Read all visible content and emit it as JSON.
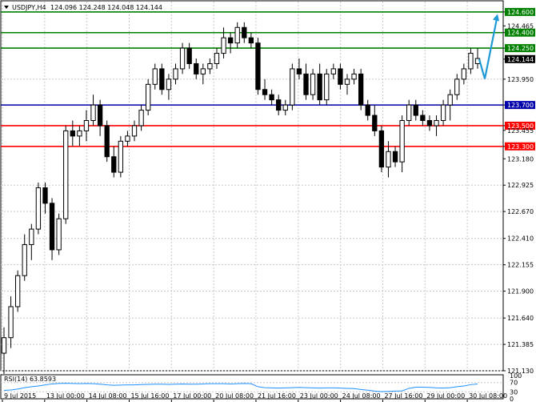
{
  "header": {
    "symbol": "USDJPY,H4",
    "ohlc": "124.096 124.248 124.048 124.144"
  },
  "colors": {
    "green_level": "#008000",
    "blue_level": "#0000aa",
    "red_level": "#ff0000",
    "rsi_line": "#1e90ff",
    "forecast_arrow": "#1e9ad6",
    "grid": "#c8c8c8",
    "candle": "#000000"
  },
  "chart_data": [
    {
      "type": "candlestick",
      "title": "USDJPY,H4",
      "ohlc_text": "124.096 124.248 124.048 124.144",
      "ylim": [
        121.13,
        124.7
      ],
      "y_ticks": [
        "124.600",
        "124.465",
        "124.400",
        "124.250",
        "124.144",
        "123.950",
        "123.700",
        "123.500",
        "123.455",
        "123.300",
        "123.180",
        "122.925",
        "122.670",
        "122.410",
        "122.155",
        "121.900",
        "121.640",
        "121.385",
        "121.130"
      ],
      "x_tick_labels": [
        "9 Jul 2015",
        "13 Jul 00:00",
        "14 Jul 08:00",
        "15 Jul 16:00",
        "17 Jul 00:00",
        "20 Jul 08:00",
        "21 Jul 16:00",
        "23 Jul 00:00",
        "24 Jul 08:00",
        "27 Jul 16:00",
        "29 Jul 00:00",
        "30 Jul 08:00"
      ],
      "current_price": 124.144,
      "levels": [
        {
          "label": "124.600",
          "value": 124.6,
          "color": "green"
        },
        {
          "label": "124.400",
          "value": 124.4,
          "color": "green"
        },
        {
          "label": "124.250",
          "value": 124.25,
          "color": "green"
        },
        {
          "label": "123.700",
          "value": 123.7,
          "color": "blue"
        },
        {
          "label": "123.500",
          "value": 123.5,
          "color": "red"
        },
        {
          "label": "123.300",
          "value": 123.3,
          "color": "red"
        }
      ],
      "candles": [
        [
          121.3,
          121.55,
          121.1,
          121.45
        ],
        [
          121.45,
          121.85,
          121.35,
          121.75
        ],
        [
          121.75,
          122.1,
          121.7,
          122.05
        ],
        [
          122.05,
          122.45,
          122.0,
          122.35
        ],
        [
          122.35,
          122.55,
          122.2,
          122.5
        ],
        [
          122.5,
          122.95,
          122.45,
          122.9
        ],
        [
          122.9,
          122.95,
          122.65,
          122.75
        ],
        [
          122.75,
          122.8,
          122.2,
          122.3
        ],
        [
          122.3,
          122.65,
          122.25,
          122.6
        ],
        [
          122.6,
          123.5,
          122.55,
          123.45
        ],
        [
          123.45,
          123.55,
          123.3,
          123.4
        ],
        [
          123.4,
          123.5,
          123.3,
          123.45
        ],
        [
          123.45,
          123.65,
          123.35,
          123.55
        ],
        [
          123.55,
          123.8,
          123.5,
          123.7
        ],
        [
          123.7,
          123.75,
          123.4,
          123.5
        ],
        [
          123.5,
          123.55,
          123.15,
          123.2
        ],
        [
          123.2,
          123.3,
          123.0,
          123.05
        ],
        [
          123.05,
          123.4,
          123.0,
          123.35
        ],
        [
          123.35,
          123.45,
          123.3,
          123.4
        ],
        [
          123.4,
          123.55,
          123.35,
          123.5
        ],
        [
          123.5,
          123.7,
          123.45,
          123.65
        ],
        [
          123.65,
          123.95,
          123.6,
          123.9
        ],
        [
          123.9,
          124.1,
          123.85,
          124.05
        ],
        [
          124.05,
          124.1,
          123.8,
          123.85
        ],
        [
          123.85,
          124.0,
          123.75,
          123.95
        ],
        [
          123.95,
          124.1,
          123.9,
          124.05
        ],
        [
          124.05,
          124.3,
          124.0,
          124.25
        ],
        [
          124.25,
          124.3,
          124.05,
          124.1
        ],
        [
          124.1,
          124.15,
          123.95,
          124.0
        ],
        [
          124.0,
          124.1,
          123.9,
          124.05
        ],
        [
          124.05,
          124.15,
          124.0,
          124.1
        ],
        [
          124.1,
          124.25,
          124.05,
          124.2
        ],
        [
          124.2,
          124.45,
          124.15,
          124.35
        ],
        [
          124.35,
          124.4,
          124.2,
          124.3
        ],
        [
          124.3,
          124.5,
          124.25,
          124.45
        ],
        [
          124.45,
          124.5,
          124.3,
          124.35
        ],
        [
          124.35,
          124.4,
          124.25,
          124.3
        ],
        [
          124.3,
          124.35,
          123.8,
          123.85
        ],
        [
          123.85,
          123.95,
          123.75,
          123.8
        ],
        [
          123.8,
          123.85,
          123.7,
          123.75
        ],
        [
          123.75,
          123.8,
          123.6,
          123.65
        ],
        [
          123.65,
          123.75,
          123.6,
          123.7
        ],
        [
          123.7,
          124.1,
          123.65,
          124.05
        ],
        [
          124.05,
          124.15,
          123.95,
          124.0
        ],
        [
          124.0,
          124.1,
          123.75,
          123.8
        ],
        [
          123.8,
          124.05,
          123.75,
          124.0
        ],
        [
          124.0,
          124.1,
          123.7,
          123.75
        ],
        [
          123.75,
          124.05,
          123.7,
          124.0
        ],
        [
          124.0,
          124.1,
          123.95,
          124.05
        ],
        [
          124.05,
          124.1,
          123.85,
          123.9
        ],
        [
          123.9,
          124.0,
          123.8,
          123.95
        ],
        [
          123.95,
          124.05,
          123.9,
          124.0
        ],
        [
          124.0,
          124.05,
          123.65,
          123.7
        ],
        [
          123.7,
          123.75,
          123.55,
          123.6
        ],
        [
          123.6,
          123.7,
          123.4,
          123.45
        ],
        [
          123.45,
          123.5,
          123.05,
          123.1
        ],
        [
          123.1,
          123.35,
          123.0,
          123.25
        ],
        [
          123.25,
          123.3,
          123.1,
          123.15
        ],
        [
          123.15,
          123.6,
          123.05,
          123.55
        ],
        [
          123.55,
          123.75,
          123.5,
          123.7
        ],
        [
          123.7,
          123.75,
          123.55,
          123.6
        ],
        [
          123.6,
          123.65,
          123.5,
          123.55
        ],
        [
          123.55,
          123.6,
          123.45,
          123.5
        ],
        [
          123.5,
          123.6,
          123.4,
          123.55
        ],
        [
          123.55,
          123.75,
          123.5,
          123.7
        ],
        [
          123.7,
          123.85,
          123.55,
          123.8
        ],
        [
          123.8,
          124.0,
          123.75,
          123.95
        ],
        [
          123.95,
          124.1,
          123.9,
          124.05
        ],
        [
          124.05,
          124.25,
          124.0,
          124.2
        ],
        [
          124.1,
          124.25,
          124.05,
          124.15
        ]
      ],
      "forecast_arrow": {
        "from_price": 124.144,
        "dip_price": 124.0,
        "to_price": 124.58
      }
    },
    {
      "type": "line",
      "title": "RSI(14) 63.8593",
      "ylim": [
        0,
        100
      ],
      "y_ticks": [
        "100",
        "70",
        "30",
        "0"
      ],
      "levels": [
        70,
        30
      ],
      "series": [
        {
          "name": "RSI(14)",
          "values": [
            36,
            38,
            42,
            48,
            52,
            55,
            60,
            64,
            66,
            67,
            66,
            65,
            66,
            65,
            63,
            60,
            58,
            59,
            60,
            60,
            61,
            62,
            63,
            63,
            62,
            63,
            64,
            63,
            63,
            64,
            65,
            65,
            65,
            64,
            65,
            66,
            65,
            52,
            48,
            47,
            46,
            47,
            48,
            49,
            48,
            47,
            46,
            47,
            47,
            46,
            45,
            44,
            40,
            37,
            33,
            31,
            32,
            33,
            34,
            45,
            50,
            50,
            49,
            47,
            46,
            48,
            52,
            55,
            61,
            63.86
          ]
        }
      ]
    }
  ]
}
